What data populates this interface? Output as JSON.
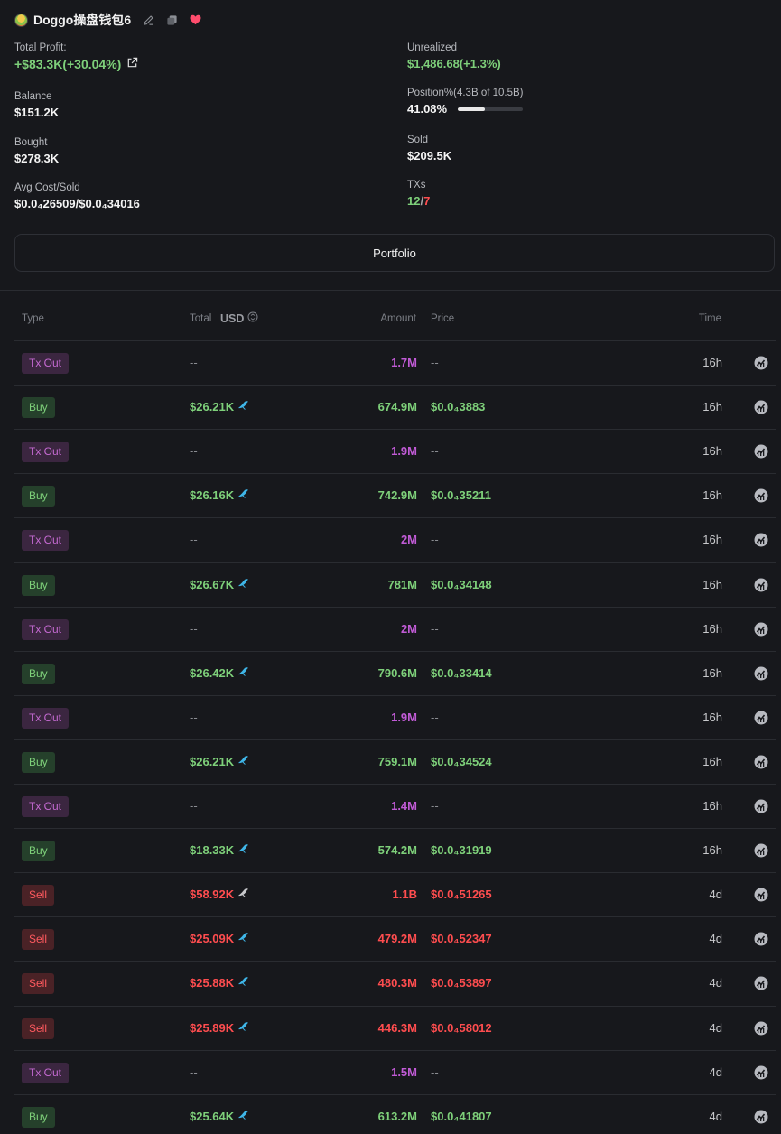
{
  "header": {
    "wallet_name": "Doggo操盘钱包6"
  },
  "stats": {
    "total_profit": {
      "label": "Total Profit:",
      "value": "+$83.3K(+30.04%)"
    },
    "unrealized": {
      "label": "Unrealized",
      "value": "$1,486.68(+1.3%)"
    },
    "balance": {
      "label": "Balance",
      "value": "$151.2K"
    },
    "position": {
      "label": "Position%(4.3B of 10.5B)",
      "value": "41.08%",
      "fill_fraction": 0.4108
    },
    "bought": {
      "label": "Bought",
      "value": "$278.3K"
    },
    "sold": {
      "label": "Sold",
      "value": "$209.5K"
    },
    "avg_cost": {
      "label": "Avg Cost/Sold",
      "value": "$0.0₄26509/$0.0₄34016"
    },
    "txs": {
      "label": "TXs",
      "buys": "12",
      "sep": "/",
      "sells": "7"
    }
  },
  "portfolio_button": "Portfolio",
  "table": {
    "headers": {
      "type": "Type",
      "total": "Total",
      "usd": "USD",
      "amount": "Amount",
      "price": "Price",
      "time": "Time"
    },
    "rows": [
      {
        "type": "Tx Out",
        "kind": "txout",
        "total": "--",
        "amount": "1.7M",
        "price": "--",
        "time": "16h"
      },
      {
        "type": "Buy",
        "kind": "buy",
        "total": "$26.21K",
        "amount": "674.9M",
        "price": "$0.0₄3883",
        "time": "16h"
      },
      {
        "type": "Tx Out",
        "kind": "txout",
        "total": "--",
        "amount": "1.9M",
        "price": "--",
        "time": "16h"
      },
      {
        "type": "Buy",
        "kind": "buy",
        "total": "$26.16K",
        "amount": "742.9M",
        "price": "$0.0₄35211",
        "time": "16h"
      },
      {
        "type": "Tx Out",
        "kind": "txout",
        "total": "--",
        "amount": "2M",
        "price": "--",
        "time": "16h"
      },
      {
        "type": "Buy",
        "kind": "buy",
        "total": "$26.67K",
        "amount": "781M",
        "price": "$0.0₄34148",
        "time": "16h"
      },
      {
        "type": "Tx Out",
        "kind": "txout",
        "total": "--",
        "amount": "2M",
        "price": "--",
        "time": "16h"
      },
      {
        "type": "Buy",
        "kind": "buy",
        "total": "$26.42K",
        "amount": "790.6M",
        "price": "$0.0₄33414",
        "time": "16h"
      },
      {
        "type": "Tx Out",
        "kind": "txout",
        "total": "--",
        "amount": "1.9M",
        "price": "--",
        "time": "16h"
      },
      {
        "type": "Buy",
        "kind": "buy",
        "total": "$26.21K",
        "amount": "759.1M",
        "price": "$0.0₄34524",
        "time": "16h"
      },
      {
        "type": "Tx Out",
        "kind": "txout",
        "total": "--",
        "amount": "1.4M",
        "price": "--",
        "time": "16h"
      },
      {
        "type": "Buy",
        "kind": "buy",
        "total": "$18.33K",
        "amount": "574.2M",
        "price": "$0.0₄31919",
        "time": "16h"
      },
      {
        "type": "Sell",
        "kind": "sell",
        "total": "$58.92K",
        "amount": "1.1B",
        "price": "$0.0₄51265",
        "time": "4d"
      },
      {
        "type": "Sell",
        "kind": "sell",
        "total": "$25.09K",
        "amount": "479.2M",
        "price": "$0.0₄52347",
        "time": "4d"
      },
      {
        "type": "Sell",
        "kind": "sell",
        "total": "$25.88K",
        "amount": "480.3M",
        "price": "$0.0₄53897",
        "time": "4d"
      },
      {
        "type": "Sell",
        "kind": "sell",
        "total": "$25.89K",
        "amount": "446.3M",
        "price": "$0.0₄58012",
        "time": "4d"
      },
      {
        "type": "Tx Out",
        "kind": "txout",
        "total": "--",
        "amount": "1.5M",
        "price": "--",
        "time": "4d"
      },
      {
        "type": "Buy",
        "kind": "buy",
        "total": "$25.64K",
        "amount": "613.2M",
        "price": "$0.0₄41807",
        "time": "4d"
      }
    ]
  },
  "colors": {
    "green": "#7ed07a",
    "red": "#ff4d4f",
    "purple": "#c15bd6",
    "fish": "#3fb6e8"
  },
  "icons": [
    "wallet-avatar-icon",
    "edit-icon",
    "copy-icon",
    "heart-icon",
    "external-link-icon",
    "usd-toggle-icon",
    "fish-icon",
    "chart-icon"
  ]
}
